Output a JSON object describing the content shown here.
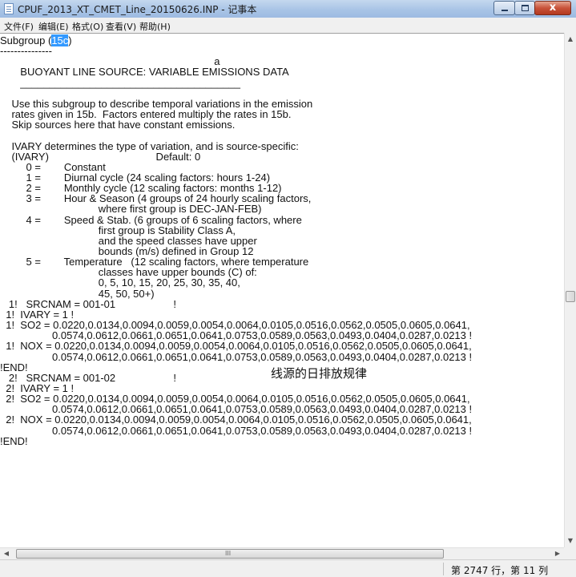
{
  "window": {
    "title": "CPUF_2013_XT_CMET_Line_20150626.INP - 记事本",
    "close_glyph": "x"
  },
  "menu": [
    "文件(F)",
    "编辑(E)",
    "格式(O)",
    "查看(V)",
    "帮助(H)"
  ],
  "editor": {
    "first_line_prefix": "Subgroup (",
    "first_line_selected": "15c",
    "first_line_suffix": ")",
    "lines": [
      "---------------",
      "                                                                          a",
      "       BUOYANT LINE SOURCE: VARIABLE EMISSIONS DATA",
      "       ______________________________________",
      "",
      "    Use this subgroup to describe temporal variations in the emission",
      "    rates given in 15b.  Factors entered multiply the rates in 15b.",
      "    Skip sources here that have constant emissions.",
      "",
      "    IVARY determines the type of variation, and is source-specific:",
      "    (IVARY)                                     Default: 0",
      "         0 =        Constant",
      "         1 =        Diurnal cycle (24 scaling factors: hours 1-24)",
      "         2 =        Monthly cycle (12 scaling factors: months 1-12)",
      "         3 =        Hour & Season (4 groups of 24 hourly scaling factors,",
      "                                  where first group is DEC-JAN-FEB)",
      "         4 =        Speed & Stab. (6 groups of 6 scaling factors, where",
      "                                  first group is Stability Class A,",
      "                                  and the speed classes have upper",
      "                                  bounds (m/s) defined in Group 12",
      "         5 =        Temperature   (12 scaling factors, where temperature",
      "                                  classes have upper bounds (C) of:",
      "                                  0, 5, 10, 15, 20, 25, 30, 35, 40,",
      "                                  45, 50, 50+)",
      "   1!   SRCNAM = 001-01                    !",
      "  1!  IVARY = 1 !",
      "  1!  SO2 = 0.0220,0.0134,0.0094,0.0059,0.0054,0.0064,0.0105,0.0516,0.0562,0.0505,0.0605,0.0641,",
      "                  0.0574,0.0612,0.0661,0.0651,0.0641,0.0753,0.0589,0.0563,0.0493,0.0404,0.0287,0.0213 !",
      "  1!  NOX = 0.0220,0.0134,0.0094,0.0059,0.0054,0.0064,0.0105,0.0516,0.0562,0.0505,0.0605,0.0641,",
      "                  0.0574,0.0612,0.0661,0.0651,0.0641,0.0753,0.0589,0.0563,0.0493,0.0404,0.0287,0.0213 !",
      "!END!",
      "   2!   SRCNAM = 001-02                    !",
      "  2!  IVARY = 1 !",
      "  2!  SO2 = 0.0220,0.0134,0.0094,0.0059,0.0054,0.0064,0.0105,0.0516,0.0562,0.0505,0.0605,0.0641,",
      "                  0.0574,0.0612,0.0661,0.0651,0.0641,0.0753,0.0589,0.0563,0.0493,0.0404,0.0287,0.0213 !",
      "  2!  NOX = 0.0220,0.0134,0.0094,0.0059,0.0054,0.0064,0.0105,0.0516,0.0562,0.0505,0.0605,0.0641,",
      "                  0.0574,0.0612,0.0661,0.0651,0.0641,0.0753,0.0589,0.0563,0.0493,0.0404,0.0287,0.0213 !",
      "!END!"
    ],
    "annotation": "线源的日排放规律"
  },
  "scrollbars": {
    "up_arrow": "▲",
    "down_arrow": "▼",
    "left_arrow": "◀",
    "right_arrow": "▶",
    "grip": "III"
  },
  "status": {
    "position_text": "第 2747 行，第 11 列"
  }
}
